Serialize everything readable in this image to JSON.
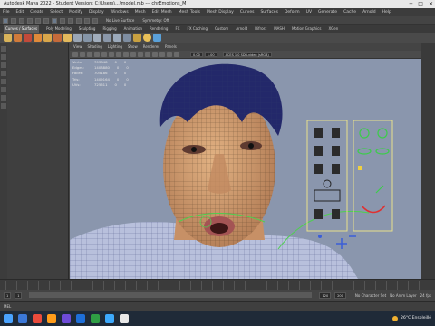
{
  "window": {
    "title": "Autodesk Maya 2022 - Student Version: C:\\Users\\...\\model.mb --- chrEmotions_M",
    "controls": [
      "─",
      "□",
      "✕"
    ]
  },
  "menubar": [
    "File",
    "Edit",
    "Create",
    "Select",
    "Modify",
    "Display",
    "Windows",
    "Mesh",
    "Edit Mesh",
    "Mesh Tools",
    "Mesh Display",
    "Curves",
    "Surfaces",
    "Deform",
    "UV",
    "Generate",
    "Cache",
    "Arnold",
    "Help"
  ],
  "statusline": {
    "surface_label": "No Live Surface",
    "symmetry_label": "Symmetry: Off"
  },
  "shelf_tabs": [
    "Curves / Surfaces",
    "Poly Modeling",
    "Sculpting",
    "Rigging",
    "Animation",
    "Rendering",
    "FX",
    "FX Caching",
    "Custom",
    "Arnold",
    "Bifrost",
    "MASH",
    "Motion Graphics",
    "XGen"
  ],
  "shelf_current": "Curves / Surfaces",
  "viewport": {
    "menu": [
      "View",
      "Shading",
      "Lighting",
      "Show",
      "Renderer",
      "Panels"
    ],
    "field_a": "0.00",
    "field_b": "1.00",
    "colorspace": "ACES 1.0 SDR-video (sRGB)"
  },
  "hud": [
    {
      "label": "Verts:",
      "v1": "703848",
      "v2": "0",
      "v3": "0"
    },
    {
      "label": "Edges:",
      "v1": "1408880",
      "v2": "0",
      "v3": "0"
    },
    {
      "label": "Faces:",
      "v1": "705186",
      "v2": "0",
      "v3": "0"
    },
    {
      "label": "Tris:",
      "v1": "1409164",
      "v2": "0",
      "v3": "0"
    },
    {
      "label": "UVs:",
      "v1": "725611",
      "v2": "0",
      "v3": "0"
    }
  ],
  "range": {
    "start": "1",
    "start2": "1",
    "end": "120",
    "end2": "200",
    "character_set": "No Character Set",
    "anim_layer": "No Anim Layer",
    "fps": "24 fps"
  },
  "cmdline": {
    "label": "MEL"
  },
  "tray": {
    "weather": "26°C  Ensoleillé"
  },
  "taskbar_colors": [
    "#3b78d8",
    "#e94b3c",
    "#ff9c1a",
    "#6e4bd8",
    "#1e6fd9",
    "#2f9e44",
    "#3da9fc",
    "#e8e8e8"
  ]
}
